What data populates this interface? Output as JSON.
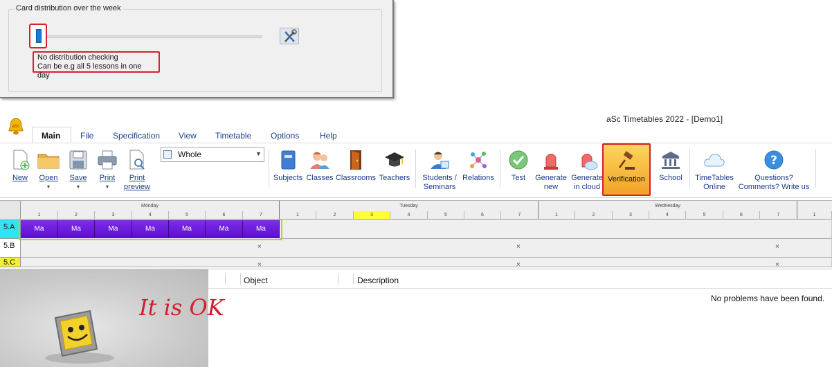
{
  "dialog": {
    "group_title": "Card distribution over the week",
    "hint_line1": "No distribution checking",
    "hint_line2": "Can be e.g all 5 lessons in one day",
    "slider_level": 0
  },
  "app": {
    "title": "aSc Timetables 2022  - [Demo1]"
  },
  "menu": {
    "tabs": [
      {
        "label": "Main"
      },
      {
        "label": "File"
      },
      {
        "label": "Specification"
      },
      {
        "label": "View"
      },
      {
        "label": "Timetable"
      },
      {
        "label": "Options"
      },
      {
        "label": "Help"
      }
    ]
  },
  "ribbon": {
    "new": "New",
    "open": "Open",
    "save": "Save",
    "print": "Print",
    "print_preview_1": "Print",
    "print_preview_2": "preview",
    "view_select": "Whole",
    "subjects": "Subjects",
    "classes": "Classes",
    "classrooms": "Classrooms",
    "teachers": "Teachers",
    "students_1": "Students /",
    "students_2": "Seminars",
    "relations": "Relations",
    "test": "Test",
    "generate_new_1": "Generate",
    "generate_new_2": "new",
    "generate_cloud_1": "Generate",
    "generate_cloud_2": "in cloud",
    "verification": "Verification",
    "school": "School",
    "timetables_online_1": "TimeTables",
    "timetables_online_2": "Online",
    "questions_1": "Questions?",
    "questions_2": "Comments? Write us"
  },
  "grid": {
    "days": [
      "Monday",
      "Tuesday",
      "Wednesday"
    ],
    "periods": [
      "1",
      "2",
      "3",
      "4",
      "5",
      "6",
      "7"
    ],
    "rows": [
      "5.A",
      "5.B",
      "5.C"
    ],
    "lesson_label": "Ma",
    "marker": "×"
  },
  "results": {
    "col_object": "Object",
    "col_description": "Description",
    "message": "No problems have been found.",
    "handwritten_note": "It is OK"
  },
  "colors": {
    "highlight_red": "#d32026",
    "lesson_purple": "#6a1be0",
    "accent_blue": "#1a7bd6"
  }
}
